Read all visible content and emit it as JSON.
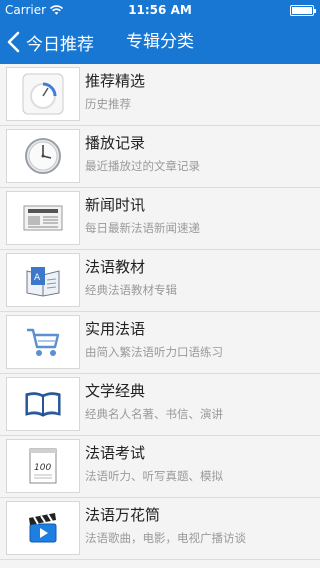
{
  "status_bar": {
    "carrier": "Carrier",
    "time": "11:56 AM"
  },
  "nav": {
    "back_label": "今日推荐",
    "title": "专辑分类"
  },
  "items": [
    {
      "title": "推荐精选",
      "subtitle": "历史推荐",
      "icon": "recommend-dial-icon"
    },
    {
      "title": "播放记录",
      "subtitle": "最近播放过的文章记录",
      "icon": "clock-icon"
    },
    {
      "title": "新闻时讯",
      "subtitle": "每日最新法语新闻速递",
      "icon": "newspaper-icon"
    },
    {
      "title": "法语教材",
      "subtitle": "经典法语教材专辑",
      "icon": "textbook-icon"
    },
    {
      "title": "实用法语",
      "subtitle": "由简入繁法语听力口语练习",
      "icon": "shopping-cart-icon"
    },
    {
      "title": "文学经典",
      "subtitle": "经典名人名著、书信、演讲",
      "icon": "open-book-icon"
    },
    {
      "title": "法语考试",
      "subtitle": "法语听力、听写真题、模拟",
      "icon": "exam-paper-icon",
      "badge_text": "100"
    },
    {
      "title": "法语万花筒",
      "subtitle": "法语歌曲，电影，电视广播访谈",
      "icon": "clapperboard-icon"
    }
  ]
}
